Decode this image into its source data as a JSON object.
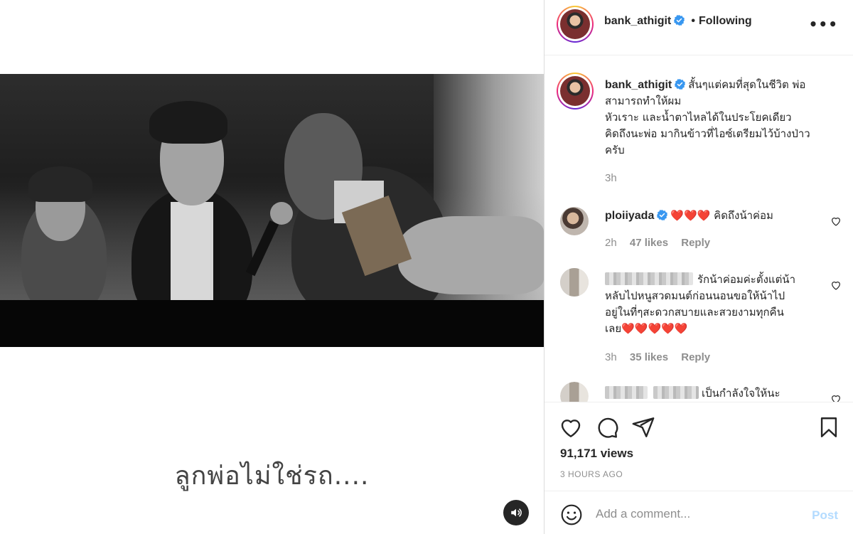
{
  "media": {
    "caption": "ลูกพ่อไม่ใช่รถ....",
    "sound_icon": "speaker-icon"
  },
  "header": {
    "username": "bank_athigit",
    "separator": "•",
    "follow_status": "Following",
    "more_label": "•••"
  },
  "post_caption": {
    "username": "bank_athigit",
    "text_lines": [
      "สั้นๆแต่คมที่สุดในชีวิต พ่อ",
      "สามารถทำให้ผม",
      "หัวเราะ และน้ำตาไหลได้ในประโยคเดียว",
      "คิดถึงนะพ่อ มากินข้าวที่ไอซ์เตรียมไว้บ้างป่าว",
      "ครับ"
    ],
    "time": "3h"
  },
  "comments": [
    {
      "username": "ploiiyada",
      "text": "❤️❤️❤️ คิดถึงน้าค่อม",
      "time": "2h",
      "likes": "47 likes",
      "reply": "Reply"
    },
    {
      "username": "",
      "text_lines": [
        "รักน้าค่อมค่ะตั้งแต่น้า",
        "หลับไปหนูสวดมนต์ก่อนนอนขอให้น้าไป",
        "อยู่ในที่ๆสะดวกสบายและสวยงามทุกคืน",
        "เลย❤️❤️❤️❤️❤️"
      ],
      "time": "3h",
      "likes": "35 likes",
      "reply": "Reply"
    },
    {
      "username": "",
      "text": "เป็นกำลังใจให้นะ"
    }
  ],
  "actions": {
    "like_icon": "heart-icon",
    "comment_icon": "comment-icon",
    "share_icon": "share-icon",
    "save_icon": "bookmark-icon",
    "views": "91,171 views",
    "time_ago": "3 HOURS AGO"
  },
  "add_comment": {
    "placeholder": "Add a comment...",
    "post_label": "Post",
    "emoji_icon": "emoji-icon"
  },
  "colors": {
    "verified": "#3897f0",
    "post_disabled": "#b3dbff",
    "heart_red": "#e0242b"
  }
}
